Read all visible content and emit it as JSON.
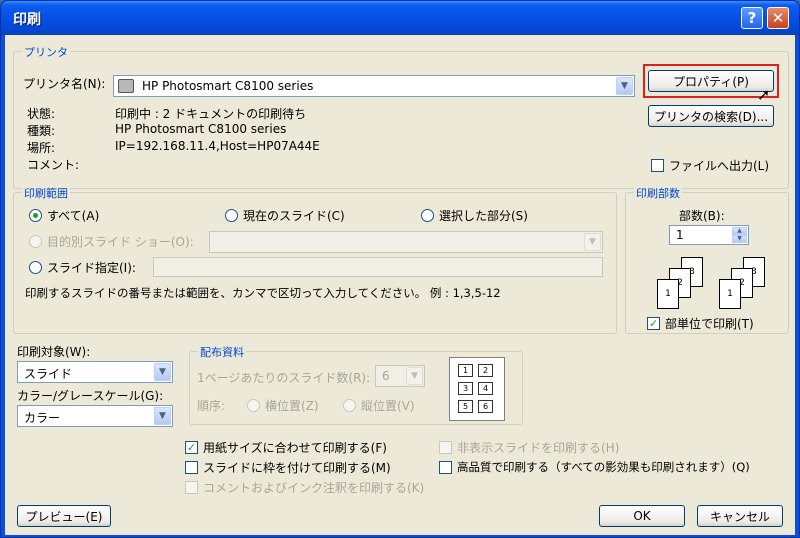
{
  "window": {
    "title": "印刷",
    "help": "?",
    "close": "✕"
  },
  "printer": {
    "group_label": "プリンタ",
    "name_label": "プリンタ名(N):",
    "name_value": "HP Photosmart C8100 series",
    "status_label": "状態:",
    "status_value": "印刷中 : 2 ドキュメントの印刷待ち",
    "type_label": "種類:",
    "type_value": "HP Photosmart C8100 series",
    "location_label": "場所:",
    "location_value": "IP=192.168.11.4,Host=HP07A44E",
    "comment_label": "コメント:",
    "properties_button": "プロパティ(P)",
    "find_button": "プリンタの検索(D)...",
    "print_to_file": "ファイルへ出力(L)"
  },
  "print_range": {
    "group_label": "印刷範囲",
    "all": "すべて(A)",
    "current_slide": "現在のスライド(C)",
    "selection": "選択した部分(S)",
    "custom_show": "目的別スライド ショー(O):",
    "slides": "スライド指定(I):",
    "hint": "印刷するスライドの番号または範囲を、カンマで区切って入力してください。 例 : 1,3,5-12"
  },
  "copies": {
    "group_label": "印刷部数",
    "count_label": "部数(B):",
    "count_value": "1",
    "collate": "部単位で印刷(T)",
    "pages": [
      "1",
      "2",
      "3",
      "1",
      "2",
      "3"
    ]
  },
  "print_what": {
    "label": "印刷対象(W):",
    "value": "スライド"
  },
  "color": {
    "label": "カラー/グレースケール(G):",
    "value": "カラー"
  },
  "handouts": {
    "group_label": "配布資料",
    "per_page_label": "1ページあたりのスライド数(R):",
    "per_page_value": "6",
    "order_label": "順序:",
    "horizontal": "横位置(Z)",
    "vertical": "縦位置(V)",
    "cells": [
      "1",
      "2",
      "3",
      "4",
      "5",
      "6"
    ]
  },
  "options": {
    "scale_to_fit": "用紙サイズに合わせて印刷する(F)",
    "frame_slides": "スライドに枠を付けて印刷する(M)",
    "comments_ink": "コメントおよびインク注釈を印刷する(K)",
    "hidden_slides": "非表示スライドを印刷する(H)",
    "high_quality": "高品質で印刷する（すべての影効果も印刷されます）(Q)"
  },
  "footer": {
    "preview": "プレビュー(E)",
    "ok": "OK",
    "cancel": "キャンセル"
  }
}
